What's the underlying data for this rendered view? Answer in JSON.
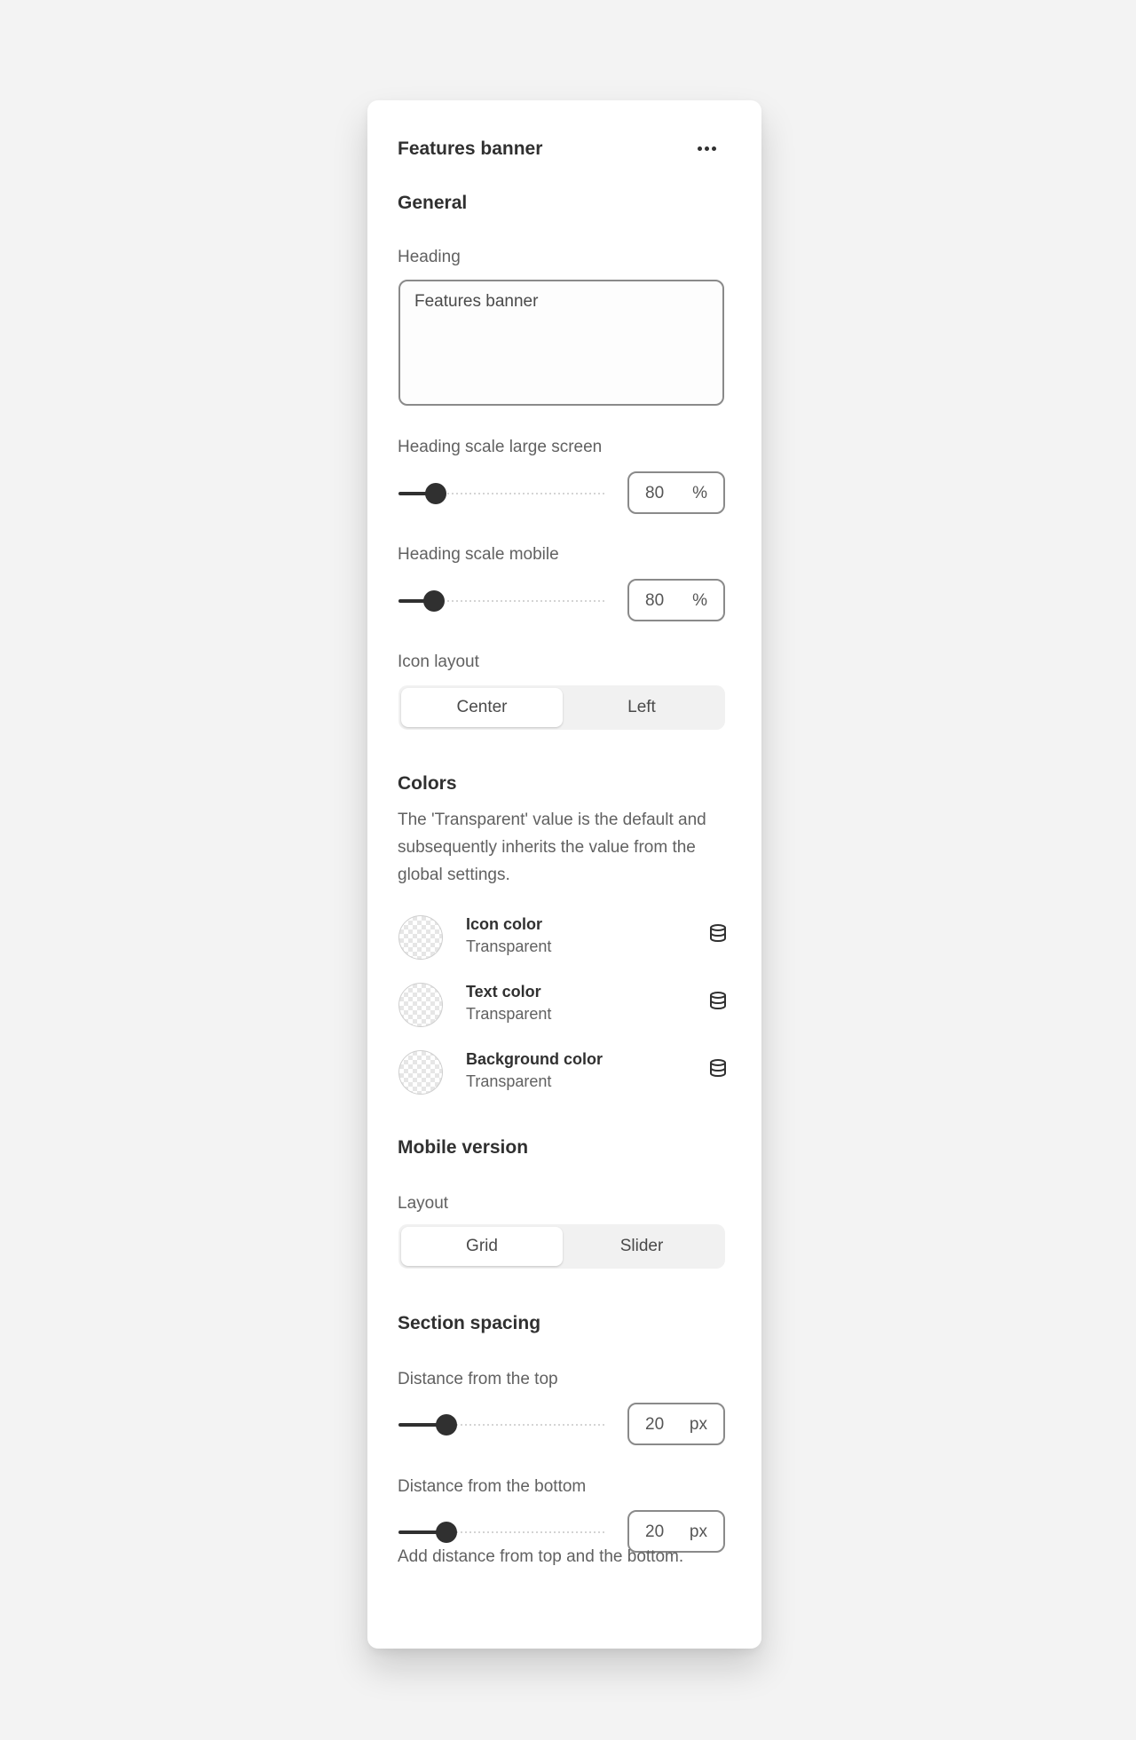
{
  "panel": {
    "title": "Features banner"
  },
  "general": {
    "title": "General",
    "heading_label": "Heading",
    "heading_value": "Features banner",
    "scale_large": {
      "label": "Heading scale large screen",
      "value": "80",
      "unit": "%",
      "fraction": 0.13
    },
    "scale_mobile": {
      "label": "Heading scale mobile",
      "value": "80",
      "unit": "%",
      "fraction": 0.12
    },
    "icon_layout": {
      "label": "Icon layout",
      "options": [
        "Center",
        "Left"
      ],
      "selected": "Center"
    }
  },
  "colors": {
    "title": "Colors",
    "description": "The 'Transparent' value is the default and subsequently inherits the value from the global settings.",
    "items": [
      {
        "name": "Icon color",
        "value": "Transparent"
      },
      {
        "name": "Text color",
        "value": "Transparent"
      },
      {
        "name": "Background color",
        "value": "Transparent"
      }
    ]
  },
  "mobile": {
    "title": "Mobile version",
    "layout_label": "Layout",
    "options": [
      "Grid",
      "Slider"
    ],
    "selected": "Grid"
  },
  "spacing": {
    "title": "Section spacing",
    "top": {
      "label": "Distance from the top",
      "value": "20",
      "unit": "px",
      "fraction": 0.18
    },
    "bottom": {
      "label": "Distance from the bottom",
      "value": "20",
      "unit": "px",
      "fraction": 0.18
    },
    "hint": "Add distance from top and the bottom."
  },
  "icons": {
    "more": "more-horizontal-icon",
    "source": "database-icon"
  },
  "style": {
    "accent": "#303030",
    "background": "#f3f3f3",
    "panel": "#ffffff"
  }
}
